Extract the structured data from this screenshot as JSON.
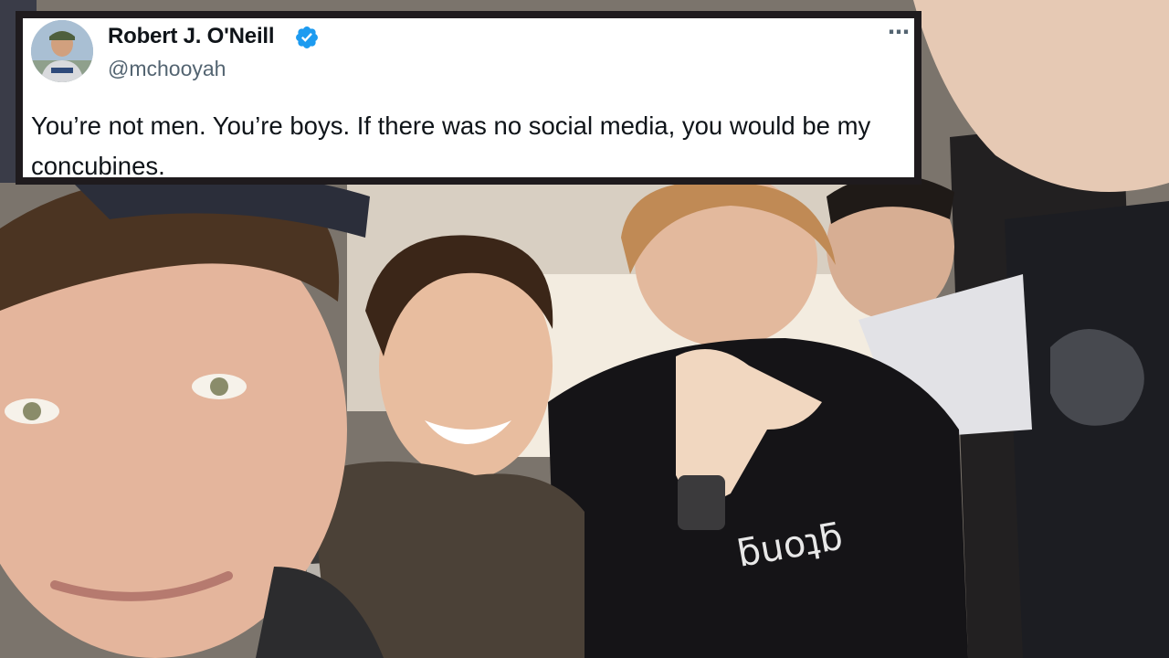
{
  "tweet": {
    "author": {
      "display_name": "Robert J. O'Neill",
      "handle": "@mchooyah",
      "verified": true,
      "avatar_icon": "profile-avatar"
    },
    "text": "You’re not men. You’re boys. If there was no social media, you would be my concubines.",
    "more_icon": "more-horizontal-icon",
    "more_label": "⋯"
  },
  "photo": {
    "description_icon": "group-selfie-photo"
  },
  "colors": {
    "verified_badge": "#1d9bf0",
    "card_border": "#1f1b1e",
    "text_primary": "#0f1419",
    "text_secondary": "#536471"
  }
}
